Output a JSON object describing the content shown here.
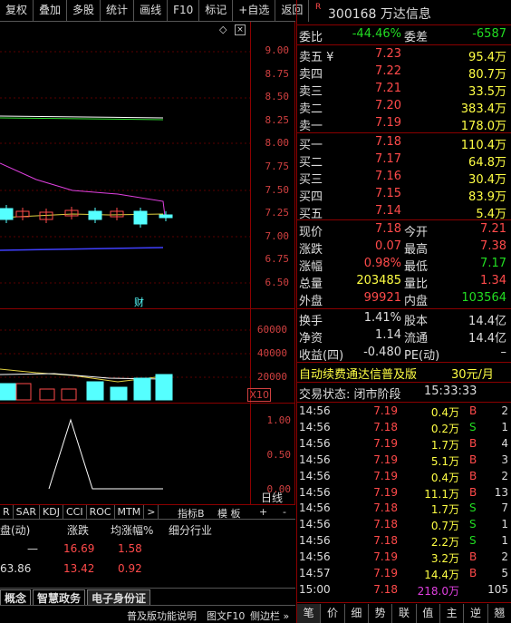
{
  "toolbar": {
    "items": [
      "复权",
      "叠加",
      "多股",
      "统计",
      "画线",
      "F10",
      "标记",
      "+自选",
      "返回"
    ]
  },
  "stock": {
    "badge": "R",
    "code_name": "300168 万达信息"
  },
  "price_axis": [
    "9.00",
    "8.75",
    "8.50",
    "8.25",
    "8.00",
    "7.75",
    "7.50",
    "7.25",
    "7.00",
    "6.75",
    "6.50"
  ],
  "candle_marker": "财",
  "vol_axis": [
    "60000",
    "40000",
    "20000"
  ],
  "vol_unit": "X10",
  "ind_axis": [
    "1.00",
    "0.50",
    "0.00"
  ],
  "indicator_tabs": [
    "R",
    "SAR",
    "KDJ",
    "CCI",
    "ROC",
    "MTM",
    ">"
  ],
  "indicator_btns": {
    "b1": "指标B",
    "b2": "模 板",
    "plus": "+",
    "minus": "-",
    "day_label": "日线"
  },
  "table": {
    "headers": [
      "盘(动)",
      "涨跌",
      "均涨幅%",
      "细分行业"
    ],
    "rows": [
      [
        "—",
        "16.69",
        "1.58",
        ""
      ],
      [
        "63.86",
        "13.42",
        "0.92",
        ""
      ]
    ]
  },
  "sector_tabs": [
    "概念",
    "智慧政务",
    "电子身份证"
  ],
  "bottom_bar": {
    "help": "普及版功能说明",
    "f10": "图文F10",
    "sidebar": "侧边栏 »"
  },
  "quote": {
    "weibi": {
      "label": "委比",
      "value": "-44.46%",
      "label2": "委差",
      "value2": "-6587"
    },
    "asks": [
      {
        "label": "卖五 ¥",
        "price": "7.23",
        "vol": "95.4万"
      },
      {
        "label": "卖四",
        "price": "7.22",
        "vol": "80.7万"
      },
      {
        "label": "卖三",
        "price": "7.21",
        "vol": "33.5万"
      },
      {
        "label": "卖二",
        "price": "7.20",
        "vol": "383.4万"
      },
      {
        "label": "卖一",
        "price": "7.19",
        "vol": "178.0万"
      }
    ],
    "bids": [
      {
        "label": "买一",
        "price": "7.18",
        "vol": "110.4万"
      },
      {
        "label": "买二",
        "price": "7.17",
        "vol": "64.8万"
      },
      {
        "label": "买三",
        "price": "7.16",
        "vol": "30.4万"
      },
      {
        "label": "买四",
        "price": "7.15",
        "vol": "83.9万"
      },
      {
        "label": "买五",
        "price": "7.14",
        "vol": "5.4万"
      }
    ],
    "stats": [
      {
        "l1": "现价",
        "v1": "7.18",
        "l2": "今开",
        "v2": "7.21"
      },
      {
        "l1": "涨跌",
        "v1": "0.07",
        "l2": "最高",
        "v2": "7.38"
      },
      {
        "l1": "涨幅",
        "v1": "0.98%",
        "l2": "最低",
        "v2": "7.17"
      },
      {
        "l1": "总量",
        "v1": "203485",
        "l2": "量比",
        "v2": "1.34"
      },
      {
        "l1": "外盘",
        "v1": "99921",
        "l2": "内盘",
        "v2": "103564"
      }
    ],
    "fund": [
      {
        "l1": "换手",
        "v1": "1.41%",
        "l2": "股本",
        "v2": "14.4亿"
      },
      {
        "l1": "净资",
        "v1": "1.14",
        "l2": "流通",
        "v2": "14.4亿"
      },
      {
        "l1": "收益(四)",
        "v1": "-0.480",
        "l2": "PE(动)",
        "v2": "–"
      }
    ],
    "promo": {
      "text": "自动续费通达信普及版",
      "price": "30元/月"
    },
    "status": {
      "label": "交易状态: 闭市阶段",
      "time": "15:33:33"
    }
  },
  "ticks": [
    {
      "t": "14:56",
      "p": "7.19",
      "v": "0.4万",
      "s": "B",
      "n": "2"
    },
    {
      "t": "14:56",
      "p": "7.18",
      "v": "0.2万",
      "s": "S",
      "n": "1"
    },
    {
      "t": "14:56",
      "p": "7.19",
      "v": "1.7万",
      "s": "B",
      "n": "4"
    },
    {
      "t": "14:56",
      "p": "7.19",
      "v": "5.1万",
      "s": "B",
      "n": "3"
    },
    {
      "t": "14:56",
      "p": "7.19",
      "v": "0.4万",
      "s": "B",
      "n": "2"
    },
    {
      "t": "14:56",
      "p": "7.19",
      "v": "11.1万",
      "s": "B",
      "n": "13"
    },
    {
      "t": "14:56",
      "p": "7.18",
      "v": "1.7万",
      "s": "S",
      "n": "7"
    },
    {
      "t": "14:56",
      "p": "7.18",
      "v": "0.7万",
      "s": "S",
      "n": "1"
    },
    {
      "t": "14:56",
      "p": "7.18",
      "v": "2.2万",
      "s": "S",
      "n": "1"
    },
    {
      "t": "14:56",
      "p": "7.19",
      "v": "3.2万",
      "s": "B",
      "n": "2"
    },
    {
      "t": "14:57",
      "p": "7.19",
      "v": "14.4万",
      "s": "B",
      "n": "5"
    },
    {
      "t": "15:00",
      "p": "7.18",
      "v": "218.0万",
      "s": "",
      "n": "105"
    }
  ],
  "right_tabs": [
    "笔",
    "价",
    "细",
    "势",
    "联",
    "值",
    "主",
    "逆",
    "翘"
  ],
  "colors": {
    "up": "#ff4a4a",
    "down": "#22dd22",
    "candle_up": "#5ff",
    "frame": "#8b0000"
  }
}
